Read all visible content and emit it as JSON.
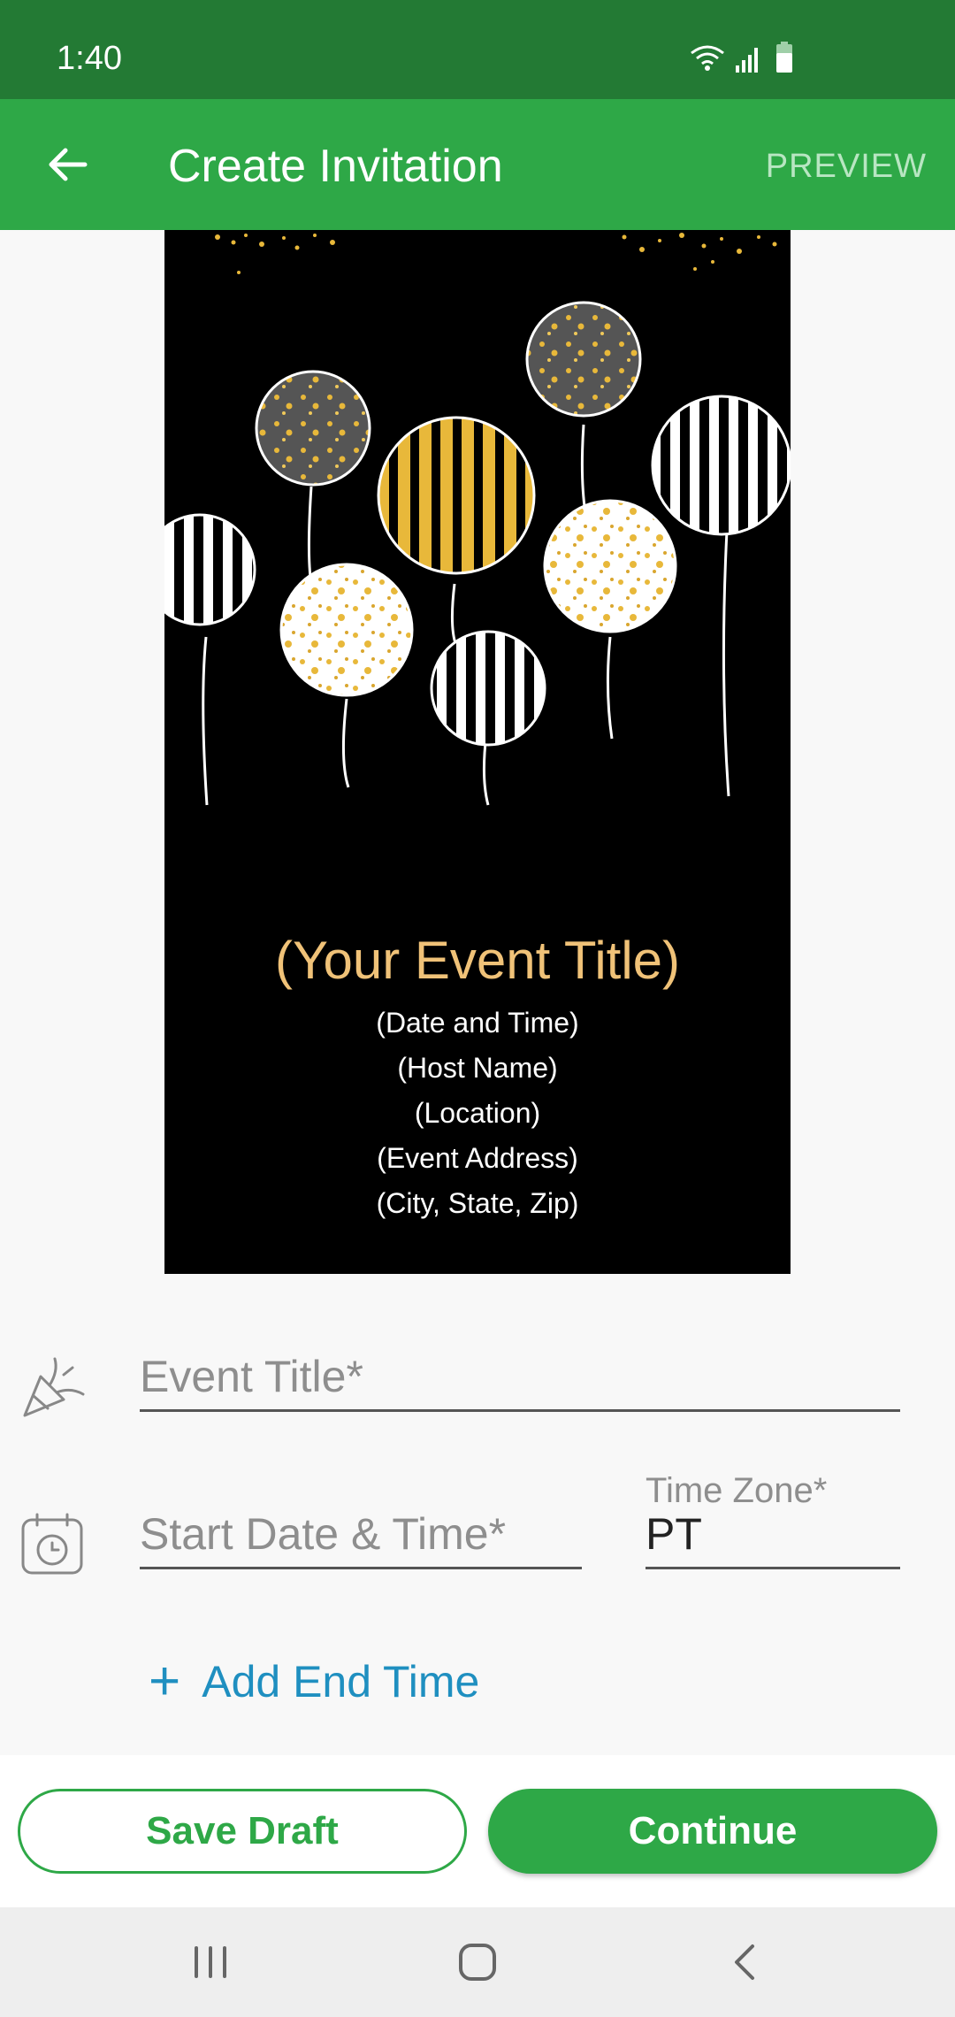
{
  "status_bar": {
    "time": "1:40"
  },
  "app_bar": {
    "title": "Create Invitation",
    "action": "PREVIEW"
  },
  "invitation_card": {
    "title": "(Your Event Title)",
    "lines": [
      "(Date and Time)",
      "(Host Name)",
      "(Location)",
      "(Event Address)",
      "(City, State, Zip)"
    ],
    "colors": {
      "background": "#000000",
      "title": "#f0c278",
      "gold": "#e8b83a"
    }
  },
  "form": {
    "event_title": {
      "placeholder": "Event Title*"
    },
    "start_date": {
      "placeholder": "Start Date & Time*"
    },
    "time_zone": {
      "label": "Time Zone*",
      "value": "PT"
    },
    "add_end_time": {
      "icon": "+",
      "label": "Add End Time"
    }
  },
  "actions": {
    "save_draft": "Save Draft",
    "continue": "Continue"
  },
  "theme": {
    "primary": "#2ea847",
    "status_bar": "#237a34",
    "link": "#1f8fc0"
  },
  "icons": [
    "back-arrow-icon",
    "wifi-icon",
    "signal-icon",
    "battery-icon",
    "party-popper-icon",
    "calendar-clock-icon",
    "recent-apps-icon",
    "home-icon",
    "back-nav-icon"
  ]
}
